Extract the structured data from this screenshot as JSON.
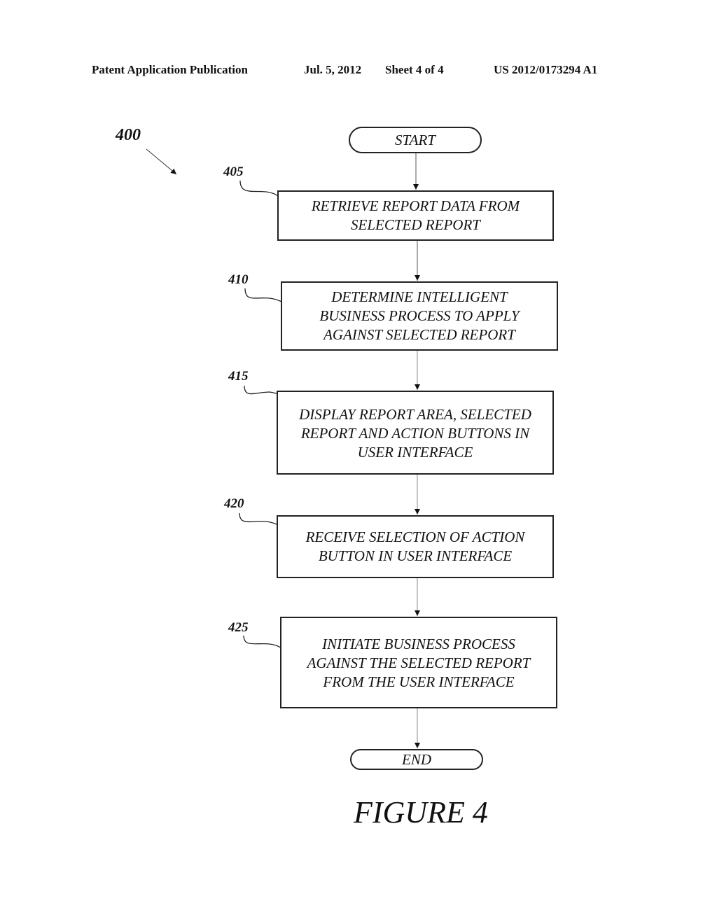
{
  "header": {
    "publication": "Patent Application Publication",
    "date": "Jul. 5, 2012",
    "sheet": "Sheet 4 of 4",
    "number": "US 2012/0173294 A1"
  },
  "figure": {
    "ref": "400",
    "caption": "FIGURE 4"
  },
  "flow": {
    "start": "START",
    "end": "END",
    "steps": [
      {
        "ref": "405",
        "text": "RETRIEVE REPORT DATA FROM\nSELECTED REPORT"
      },
      {
        "ref": "410",
        "text": "DETERMINE INTELLIGENT\nBUSINESS PROCESS TO APPLY\nAGAINST SELECTED REPORT"
      },
      {
        "ref": "415",
        "text": "DISPLAY REPORT AREA, SELECTED\nREPORT AND ACTION BUTTONS IN\nUSER INTERFACE"
      },
      {
        "ref": "420",
        "text": "RECEIVE SELECTION OF ACTION\nBUTTON IN USER INTERFACE"
      },
      {
        "ref": "425",
        "text": "INITIATE BUSINESS PROCESS\nAGAINST THE SELECTED REPORT\nFROM THE USER INTERFACE"
      }
    ]
  }
}
